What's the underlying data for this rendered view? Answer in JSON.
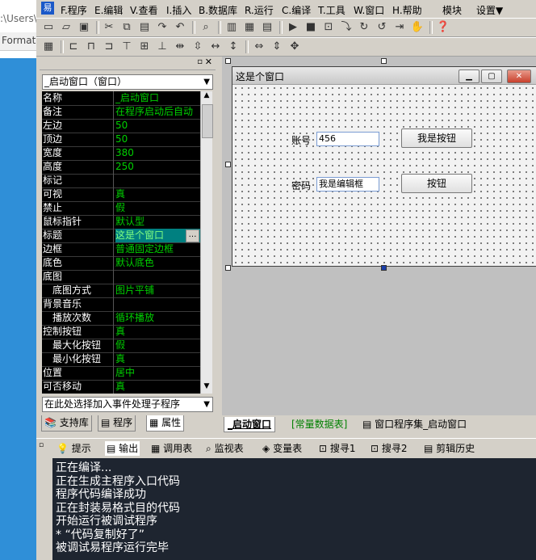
{
  "background": {
    "path_text": ":\\Users\\",
    "format_text": "Format"
  },
  "menu": [
    "F.程序",
    "E.编辑",
    "V.查看",
    "I.插入",
    "B.数据库",
    "R.运行",
    "C.编译",
    "T.工具",
    "W.窗口",
    "H.帮助",
    "模块",
    "设置▼"
  ],
  "properties": {
    "object_selector": "_启动窗口（窗口）",
    "rows": [
      {
        "key": "名称",
        "value": "_启动窗口"
      },
      {
        "key": "备注",
        "value": "在程序启动后自动"
      },
      {
        "key": "左边",
        "value": "50"
      },
      {
        "key": "顶边",
        "value": "50"
      },
      {
        "key": "宽度",
        "value": "380"
      },
      {
        "key": "高度",
        "value": "250"
      },
      {
        "key": "标记",
        "value": ""
      },
      {
        "key": "可视",
        "value": "真"
      },
      {
        "key": "禁止",
        "value": "假"
      },
      {
        "key": "鼠标指针",
        "value": "默认型"
      },
      {
        "key": "标题",
        "value": "这是个窗口"
      },
      {
        "key": "边框",
        "value": "普通固定边框"
      },
      {
        "key": "底色",
        "value": "默认底色"
      },
      {
        "key": "底图",
        "value": ""
      },
      {
        "key": "　底图方式",
        "value": "图片平铺"
      },
      {
        "key": "背景音乐",
        "value": ""
      },
      {
        "key": "　播放次数",
        "value": "循环播放"
      },
      {
        "key": "控制按钮",
        "value": "真"
      },
      {
        "key": "　最大化按钮",
        "value": "假"
      },
      {
        "key": "　最小化按钮",
        "value": "真"
      },
      {
        "key": "位置",
        "value": "居中"
      },
      {
        "key": "可否移动",
        "value": "真"
      }
    ],
    "event_selector": "在此处选择加入事件处理子程序",
    "tabs": [
      "支持库",
      "程序",
      "属性"
    ]
  },
  "form": {
    "title": "这是个窗口",
    "account_label": "账号",
    "account_value": "456",
    "button1_label": "我是按钮",
    "password_label": "密码",
    "password_value": "我是编辑框",
    "button2_label": "按钮"
  },
  "design_tabs": [
    "_启动窗口",
    "[常量数据表]",
    "窗口程序集_启动窗口"
  ],
  "output_tabs": [
    "提示",
    "输出",
    "调用表",
    "监视表",
    "变量表",
    "搜寻1",
    "搜寻2",
    "剪辑历史"
  ],
  "output_lines": [
    "正在编译...",
    "正在生成主程序入口代码",
    "程序代码编译成功",
    "正在封装易格式目的代码",
    "开始运行被调试程序",
    "* “代码复制好了”",
    "被调试易程序运行完毕"
  ],
  "colors": {
    "grid_bg": "#000000",
    "grid_value": "#00d000",
    "output_bg": "#1e2530"
  }
}
